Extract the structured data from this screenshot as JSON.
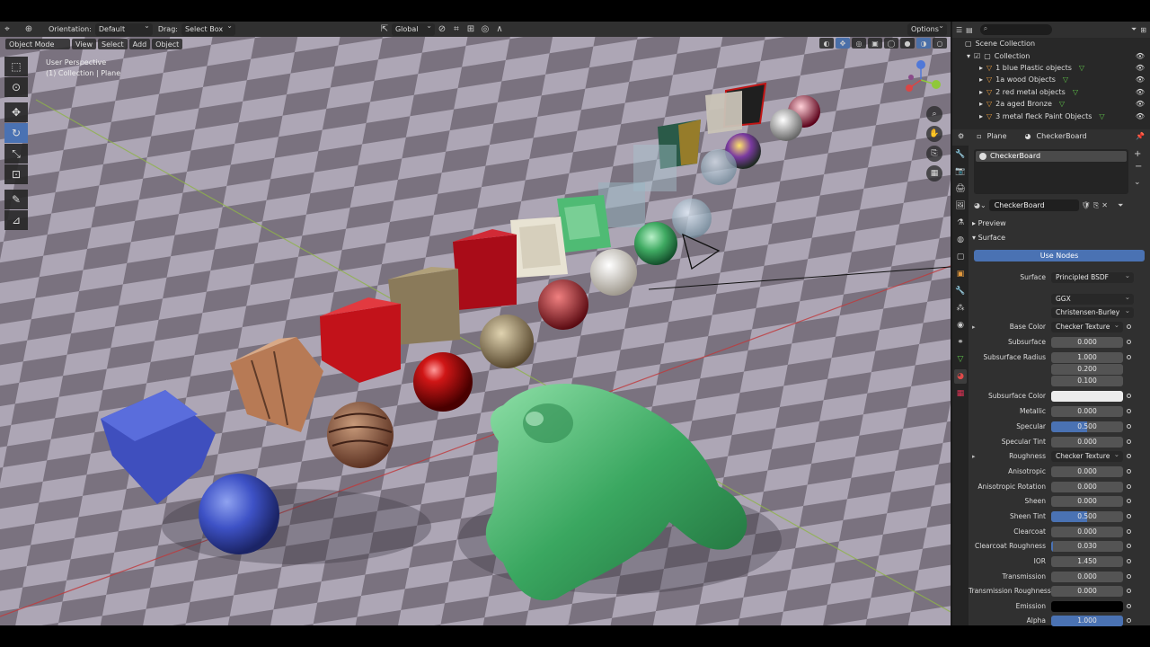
{
  "header": {
    "orientation_label": "Orientation:",
    "orientation_value": "Default",
    "drag_label": "Drag:",
    "drag_value": "Select Box",
    "transform_space": "Global",
    "options_label": "Options"
  },
  "viewport": {
    "mode": "Object Mode",
    "menus": [
      "View",
      "Select",
      "Add",
      "Object"
    ],
    "perspective": "User Perspective",
    "context": "(1) Collection | Plane"
  },
  "outliner": {
    "search_placeholder": "",
    "scene_collection": "Scene Collection",
    "collection": "Collection",
    "items": [
      "1 blue Plastic objects",
      "1a wood Objects",
      "2 red metal objects",
      "2a aged Bronze",
      "3 metal fleck Paint Objects"
    ]
  },
  "properties": {
    "object_name": "Plane",
    "material_name": "CheckerBoard",
    "slot_name": "CheckerBoard",
    "material_field": "CheckerBoard",
    "preview_label": "Preview",
    "surface_panel": "Surface",
    "use_nodes": "Use Nodes",
    "surface_label": "Surface",
    "surface_value": "Principled BSDF",
    "distribution": "GGX",
    "subsurface_method": "Christensen-Burley",
    "base_color_label": "Base Color",
    "base_color_value": "Checker Texture",
    "roughness_label": "Roughness",
    "roughness_value": "Checker Texture",
    "subsurface_color_label": "Subsurface Color",
    "emission_label": "Emission",
    "subsurface_radius_label": "Subsurface Radius",
    "subsurface_radius": [
      "1.000",
      "0.200",
      "0.100"
    ],
    "fields": [
      {
        "label": "Subsurface",
        "value": "0.000",
        "fill": 0
      },
      {
        "label": "Metallic",
        "value": "0.000",
        "fill": 0
      },
      {
        "label": "Specular",
        "value": "0.500",
        "fill": 0.5
      },
      {
        "label": "Specular Tint",
        "value": "0.000",
        "fill": 0
      },
      {
        "label": "Anisotropic",
        "value": "0.000",
        "fill": 0
      },
      {
        "label": "Anisotropic Rotation",
        "value": "0.000",
        "fill": 0
      },
      {
        "label": "Sheen",
        "value": "0.000",
        "fill": 0
      },
      {
        "label": "Sheen Tint",
        "value": "0.500",
        "fill": 0.5
      },
      {
        "label": "Clearcoat",
        "value": "0.000",
        "fill": 0
      },
      {
        "label": "Clearcoat Roughness",
        "value": "0.030",
        "fill": 0.03
      },
      {
        "label": "IOR",
        "value": "1.450",
        "fill": 0
      },
      {
        "label": "Transmission",
        "value": "0.000",
        "fill": 0
      },
      {
        "label": "Transmission Roughness",
        "value": "0.000",
        "fill": 0
      },
      {
        "label": "Alpha",
        "value": "1.000",
        "fill": 1
      }
    ]
  },
  "colors": {
    "accent": "#4a72b3",
    "panel_bg": "#303030",
    "subsurface_color": "#ececec",
    "emission_color": "#000000"
  }
}
